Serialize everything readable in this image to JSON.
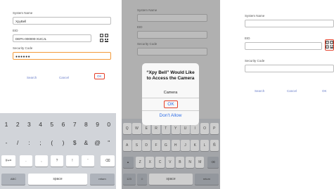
{
  "screen_left": {
    "system_name_label": "System Name",
    "system_name_value": "XpyBell",
    "eid_label": "EID",
    "eid_value": "DEPA-000000-XUCJL",
    "security_code_label": "Security Code",
    "security_code_value": "●●●●●●",
    "actions": {
      "search": "Search",
      "cancel": "Cancel",
      "ok": "OK"
    },
    "keyboard": {
      "row1": [
        "1",
        "2",
        "3",
        "4",
        "5",
        "6",
        "7",
        "8",
        "9",
        "0"
      ],
      "row2": [
        "-",
        "/",
        ":",
        ";",
        "(",
        ")",
        "$",
        "&",
        "@",
        "\""
      ],
      "row3_left": "#+=",
      "row3_mid": [
        ".",
        ",",
        "?",
        "!",
        "'"
      ],
      "row4": {
        "abc": "ABC",
        "space": "space",
        "return": "return"
      }
    }
  },
  "screen_middle": {
    "system_name_label": "System Name",
    "eid_label": "EID",
    "security_code_label": "Security Code",
    "actions": {
      "search": "Search",
      "cancel": "Cancel",
      "ok": "OK"
    },
    "dialog": {
      "title": "“Xpy Bell” Would Like to Access the Camera",
      "message": "Camera",
      "ok": "OK",
      "dont_allow": "Don't Allow"
    },
    "keyboard": {
      "row1": [
        "Q",
        "W",
        "E",
        "R",
        "T",
        "Y",
        "U",
        "I",
        "O",
        "P"
      ],
      "row2": [
        "A",
        "S",
        "D",
        "F",
        "G",
        "H",
        "J",
        "K",
        "L",
        "Ñ"
      ],
      "row3": [
        "Z",
        "X",
        "C",
        "V",
        "B",
        "N",
        "M"
      ],
      "row4": {
        "num": "123",
        "space": "space",
        "return": "return"
      }
    }
  },
  "screen_right": {
    "system_name_label": "System Name",
    "eid_label": "EID",
    "security_code_label": "Security Code",
    "actions": {
      "search": "Search",
      "cancel": "Cancel",
      "ok": "OK"
    }
  },
  "colors": {
    "highlight": "#e4402a",
    "active_field": "#f39a3a",
    "link": "#6a7ec9"
  }
}
